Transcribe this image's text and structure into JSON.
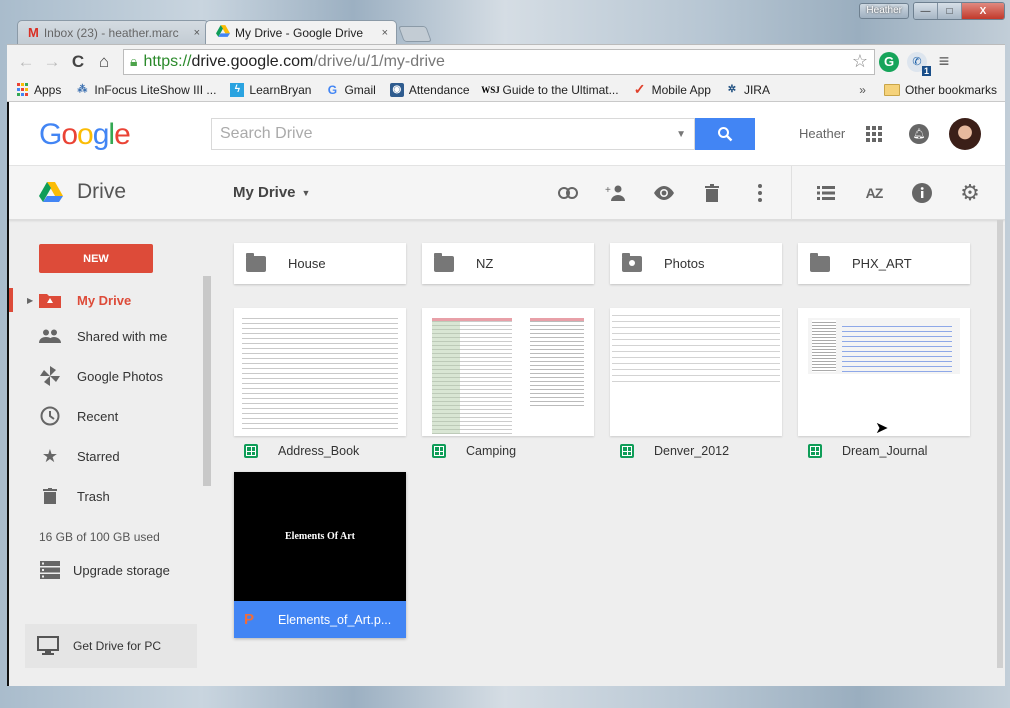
{
  "window": {
    "profile_label": "Heather",
    "minimize": "—",
    "maximize": "□",
    "close": "X"
  },
  "tabs": [
    {
      "label": "Inbox (23) - heather.marc",
      "icon": "gmail-icon",
      "close": "×"
    },
    {
      "label": "My Drive - Google Drive",
      "icon": "drive-icon",
      "close": "×",
      "active": true
    }
  ],
  "toolbar": {
    "back": "←",
    "forward": "→",
    "reload": "C",
    "home": "⌂",
    "url_scheme": "https://",
    "url_host": "drive.google.com",
    "url_path": "/drive/u/1/my-drive",
    "star": "☆",
    "ext_grammarly": "G",
    "ext_phone_badge": "1",
    "menu": "≡"
  },
  "bookmarks": {
    "items": [
      {
        "label": "Apps",
        "icon": "apps-icon"
      },
      {
        "label": "InFocus LiteShow III ...",
        "icon": "share-icon"
      },
      {
        "label": "LearnBryan",
        "icon": "bolt-icon"
      },
      {
        "label": "Gmail",
        "icon": "google-icon"
      },
      {
        "label": "Attendance",
        "icon": "camera-icon"
      },
      {
        "label": "Guide to the Ultimat...",
        "icon": "wsj-icon"
      },
      {
        "label": "Mobile App",
        "icon": "checkmark-icon"
      },
      {
        "label": "JIRA",
        "icon": "jira-icon"
      }
    ],
    "more": "»",
    "other": "Other bookmarks"
  },
  "header": {
    "logo": [
      "G",
      "o",
      "o",
      "g",
      "l",
      "e"
    ],
    "search_placeholder": "Search Drive",
    "user_name": "Heather"
  },
  "drivebar": {
    "title": "Drive",
    "location": "My Drive",
    "actions": [
      "link-icon",
      "add-person-icon",
      "preview-icon",
      "trash-icon",
      "more-vert-icon"
    ],
    "view_actions": [
      "list-view-icon",
      "sort-az-icon",
      "info-icon",
      "settings-icon"
    ]
  },
  "sidebar": {
    "new_label": "NEW",
    "items": [
      {
        "label": "My Drive",
        "active": true
      },
      {
        "label": "Shared with me"
      },
      {
        "label": "Google Photos"
      },
      {
        "label": "Recent"
      },
      {
        "label": "Starred"
      },
      {
        "label": "Trash"
      }
    ],
    "storage": "16 GB of 100 GB used",
    "upgrade": "Upgrade storage",
    "get_drive": "Get Drive for PC"
  },
  "folders": [
    {
      "name": "House",
      "type": "folder"
    },
    {
      "name": "NZ",
      "type": "folder"
    },
    {
      "name": "Photos",
      "type": "shared-folder"
    },
    {
      "name": "PHX_ART",
      "type": "folder"
    }
  ],
  "files": [
    {
      "name": "Address_Book",
      "type": "sheet"
    },
    {
      "name": "Camping",
      "type": "sheet"
    },
    {
      "name": "Denver_2012",
      "type": "sheet"
    },
    {
      "name": "Dream_Journal",
      "type": "sheet"
    },
    {
      "name": "Elements_of_Art.p...",
      "type": "presentation",
      "slide_title": "Elements Of Art",
      "selected": true
    }
  ]
}
